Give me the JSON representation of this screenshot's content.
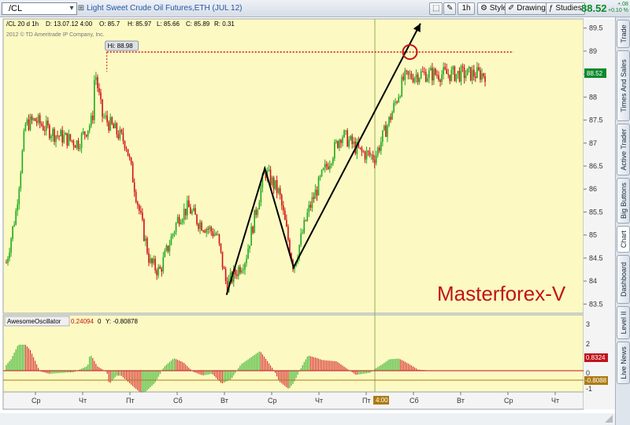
{
  "toolbar": {
    "symbol": "/CL",
    "description": "Light Sweet Crude Oil Futures,ETH (JUL 12)",
    "timeframe_label": "1h",
    "style_label": "Style",
    "drawings_label": "Drawings",
    "studies_label": "Studies",
    "last_price": "88.52",
    "net_change": "+.08",
    "net_change_pct": "+0.10 %"
  },
  "side_tabs": [
    "Trade",
    "Times And Sales",
    "Active Trader",
    "Big Buttons",
    "Chart",
    "Dashboard",
    "Level II",
    "Live News"
  ],
  "chart": {
    "header": "/CL 20 d 1h",
    "date": "D: 13.07.12 4:00",
    "open": "O: 85.7",
    "high": "H: 85.97",
    "low": "L: 85.66",
    "close": "C: 85.89",
    "range": "R: 0.31",
    "copyright": "2012 © TD Ameritrade IP Company, Inc.",
    "hi_label": "Hi: 88.98",
    "price_tag": "88.52",
    "watermark": "Masterforex-V",
    "crosshair_time": "4:00",
    "price_ticks": [
      "89.5",
      "89",
      "88.5",
      "88",
      "87.5",
      "87",
      "86.5",
      "86",
      "85.5",
      "85",
      "84.5",
      "84",
      "83.5"
    ],
    "time_ticks": [
      "Ср",
      "Чт",
      "Пт",
      "Сб",
      "Вт",
      "Ср",
      "Чт",
      "Пт",
      "Сб",
      "Вт",
      "Ср",
      "Чт"
    ]
  },
  "oscillator": {
    "name": "AwesomeOscillator",
    "value": "0.24094",
    "zero": "0",
    "y_readout": "Y: -0.80878",
    "ticks": [
      "3",
      "2",
      "1",
      "0",
      "-1"
    ],
    "tag_positive": "0.8324",
    "tag_negative": "-0.8088"
  },
  "colors": {
    "chart_bg": "#fcf9c2",
    "up_bar": "#1eaa1e",
    "down_bar": "#d0101a",
    "hi_line": "#d0101a",
    "trend_line": "#000000",
    "price_tag": "#0a8a2a",
    "osc_tag_neg": "#ad7a10"
  },
  "chart_data": {
    "type": "candlestick",
    "title": "/CL 20 d 1h",
    "price_range": [
      83.3,
      89.7
    ],
    "high_marker": 88.98,
    "last": 88.52,
    "path": [
      [
        0,
        84.4
      ],
      [
        0.02,
        85.5
      ],
      [
        0.04,
        87.4
      ],
      [
        0.06,
        87.5
      ],
      [
        0.1,
        87.2
      ],
      [
        0.15,
        87.0
      ],
      [
        0.18,
        87.5
      ],
      [
        0.185,
        88.6
      ],
      [
        0.2,
        87.6
      ],
      [
        0.25,
        87.0
      ],
      [
        0.28,
        85.4
      ],
      [
        0.3,
        84.4
      ],
      [
        0.32,
        84.2
      ],
      [
        0.36,
        85.4
      ],
      [
        0.38,
        85.6
      ],
      [
        0.4,
        85.3
      ],
      [
        0.44,
        85.0
      ],
      [
        0.46,
        83.9
      ],
      [
        0.5,
        84.5
      ],
      [
        0.54,
        86.4
      ],
      [
        0.57,
        85.9
      ],
      [
        0.6,
        84.3
      ],
      [
        0.63,
        85.5
      ],
      [
        0.66,
        86.3
      ],
      [
        0.7,
        87.2
      ],
      [
        0.74,
        86.8
      ],
      [
        0.77,
        86.7
      ],
      [
        0.8,
        87.5
      ],
      [
        0.83,
        88.4
      ],
      [
        0.86,
        88.5
      ]
    ],
    "trend_lines": [
      [
        [
          83.7,
          0.46
        ],
        [
          86.45,
          0.54
        ],
        [
          84.3,
          0.6
        ],
        [
          89.6,
          0.865
        ]
      ]
    ]
  }
}
